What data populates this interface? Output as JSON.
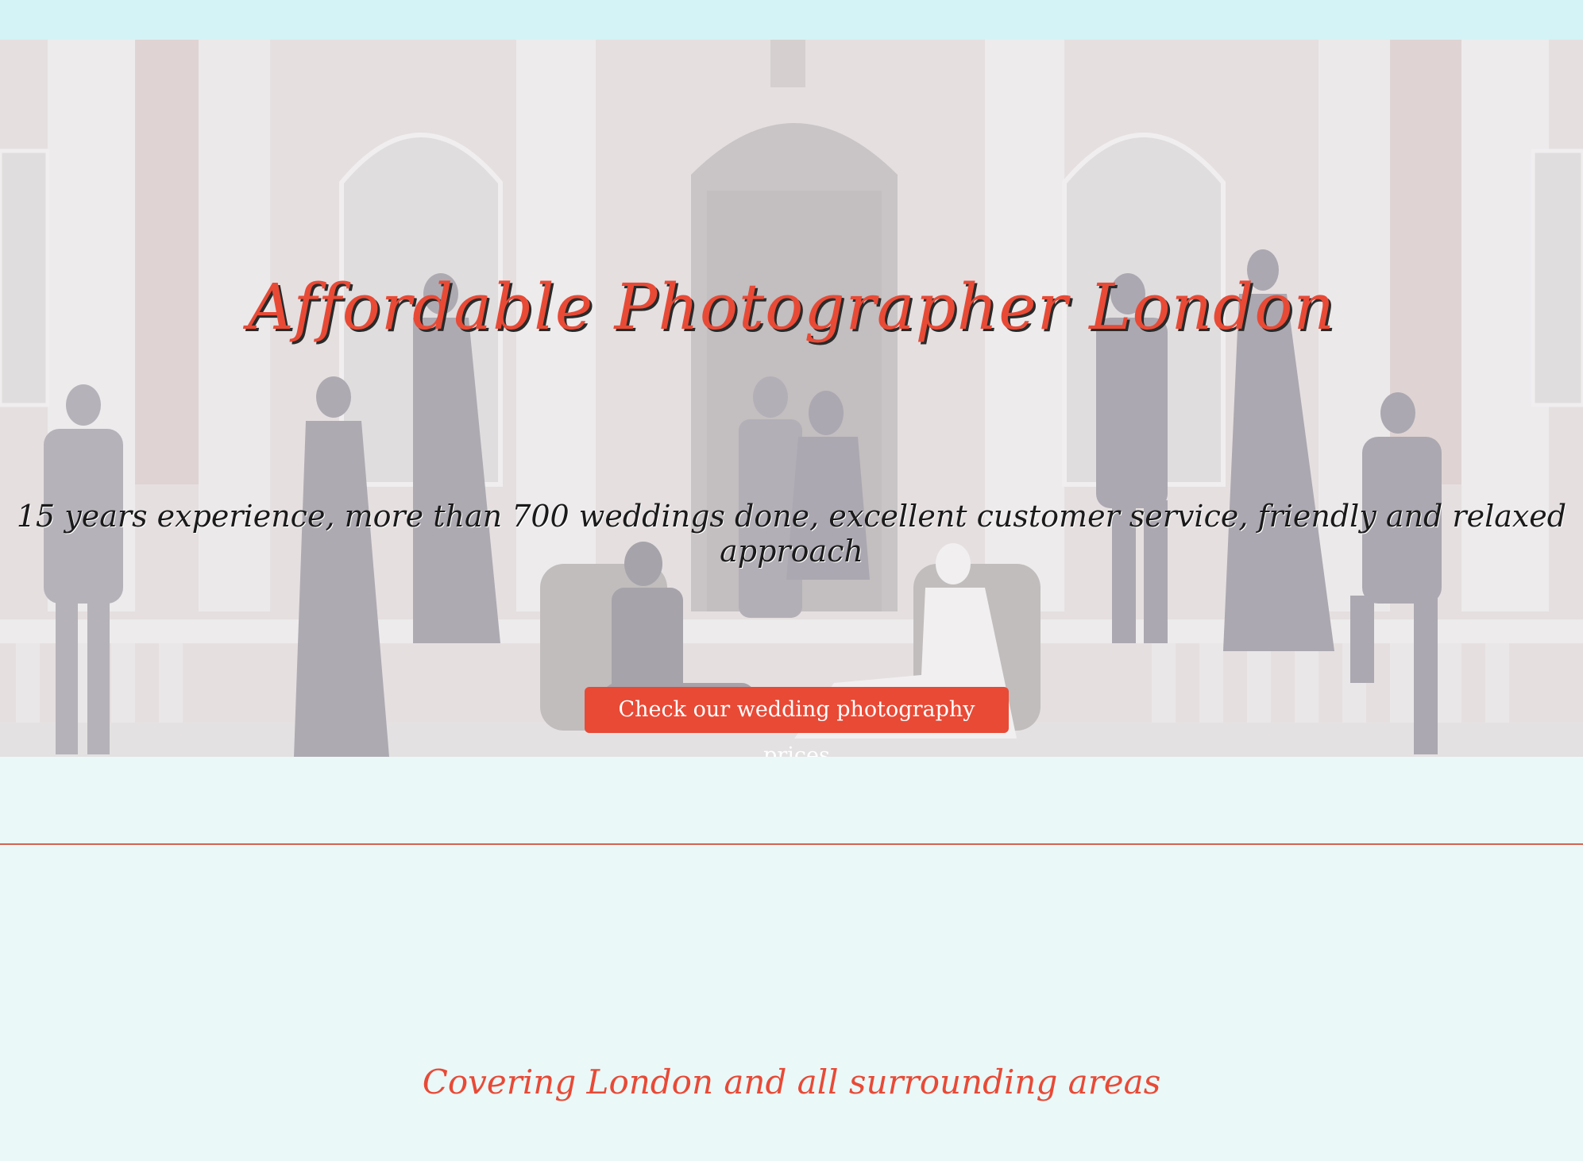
{
  "hero": {
    "title": "Affordable Photographer London",
    "subtitle": "15 years experience, more than 700 weddings done, excellent customer service, friendly and relaxed approach",
    "button_label": "Check our wedding photography prices"
  },
  "section": {
    "covering_text": "Covering London and all surrounding areas"
  },
  "colors": {
    "accent": "#e84a36",
    "topbar": "#d4f3f6",
    "page_bg": "#eaf8f8",
    "divider": "#d7624f"
  }
}
